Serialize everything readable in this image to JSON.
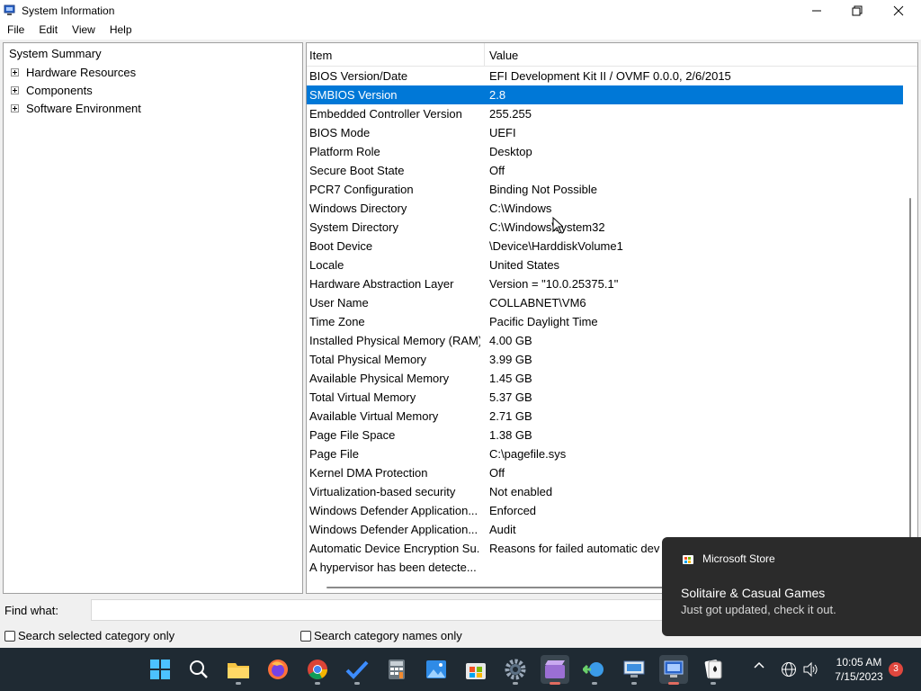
{
  "window": {
    "title": "System Information",
    "icon": "system-information-icon"
  },
  "menu": {
    "items": [
      "File",
      "Edit",
      "View",
      "Help"
    ]
  },
  "tree": {
    "root": "System Summary",
    "children": [
      "Hardware Resources",
      "Components",
      "Software Environment"
    ]
  },
  "list": {
    "columns": [
      "Item",
      "Value"
    ],
    "selected_row": "SMBIOS Version",
    "rows": [
      {
        "item": "BIOS Version/Date",
        "value": "EFI Development Kit II / OVMF 0.0.0, 2/6/2015"
      },
      {
        "item": "SMBIOS Version",
        "value": "2.8"
      },
      {
        "item": "Embedded Controller Version",
        "value": "255.255"
      },
      {
        "item": "BIOS Mode",
        "value": "UEFI"
      },
      {
        "item": "Platform Role",
        "value": "Desktop"
      },
      {
        "item": "Secure Boot State",
        "value": "Off"
      },
      {
        "item": "PCR7 Configuration",
        "value": "Binding Not Possible"
      },
      {
        "item": "Windows Directory",
        "value": "C:\\Windows"
      },
      {
        "item": "System Directory",
        "value": "C:\\Windows\\system32"
      },
      {
        "item": "Boot Device",
        "value": "\\Device\\HarddiskVolume1"
      },
      {
        "item": "Locale",
        "value": "United States"
      },
      {
        "item": "Hardware Abstraction Layer",
        "value": "Version = \"10.0.25375.1\""
      },
      {
        "item": "User Name",
        "value": "COLLABNET\\VM6"
      },
      {
        "item": "Time Zone",
        "value": "Pacific Daylight Time"
      },
      {
        "item": "Installed Physical Memory (RAM)",
        "value": "4.00 GB"
      },
      {
        "item": "Total Physical Memory",
        "value": "3.99 GB"
      },
      {
        "item": "Available Physical Memory",
        "value": "1.45 GB"
      },
      {
        "item": "Total Virtual Memory",
        "value": "5.37 GB"
      },
      {
        "item": "Available Virtual Memory",
        "value": "2.71 GB"
      },
      {
        "item": "Page File Space",
        "value": "1.38 GB"
      },
      {
        "item": "Page File",
        "value": "C:\\pagefile.sys"
      },
      {
        "item": "Kernel DMA Protection",
        "value": "Off"
      },
      {
        "item": "Virtualization-based security",
        "value": "Not enabled"
      },
      {
        "item": "Windows Defender Application...",
        "value": "Enforced"
      },
      {
        "item": "Windows Defender Application...",
        "value": "Audit"
      },
      {
        "item": "Automatic Device Encryption Su...",
        "value": "Reasons for failed automatic dev"
      },
      {
        "item": "A hypervisor has been detecte...",
        "value": ""
      }
    ]
  },
  "find": {
    "label": "Find what:",
    "value": "",
    "search_selected_label": "Search selected category only",
    "search_names_label": "Search category names only"
  },
  "toast": {
    "app": "Microsoft Store",
    "title": "Solitaire & Casual Games",
    "body": "Just got updated, check it out."
  },
  "taskbar": {
    "icons": [
      "windows-start-icon",
      "search-icon",
      "file-explorer-icon",
      "firefox-icon",
      "chrome-icon",
      "todo-icon",
      "calculator-icon",
      "photos-icon",
      "microsoft-store-icon",
      "settings-icon",
      "clipchamp-icon",
      "network-share-icon",
      "remote-desktop-icon",
      "system-information-icon",
      "solitaire-icon"
    ],
    "time": "10:05 AM",
    "date": "7/15/2023",
    "notification_count": "3"
  },
  "colors": {
    "selection": "#0078d7",
    "taskbar": "#1f2a33",
    "toast": "#2b2b2b"
  }
}
